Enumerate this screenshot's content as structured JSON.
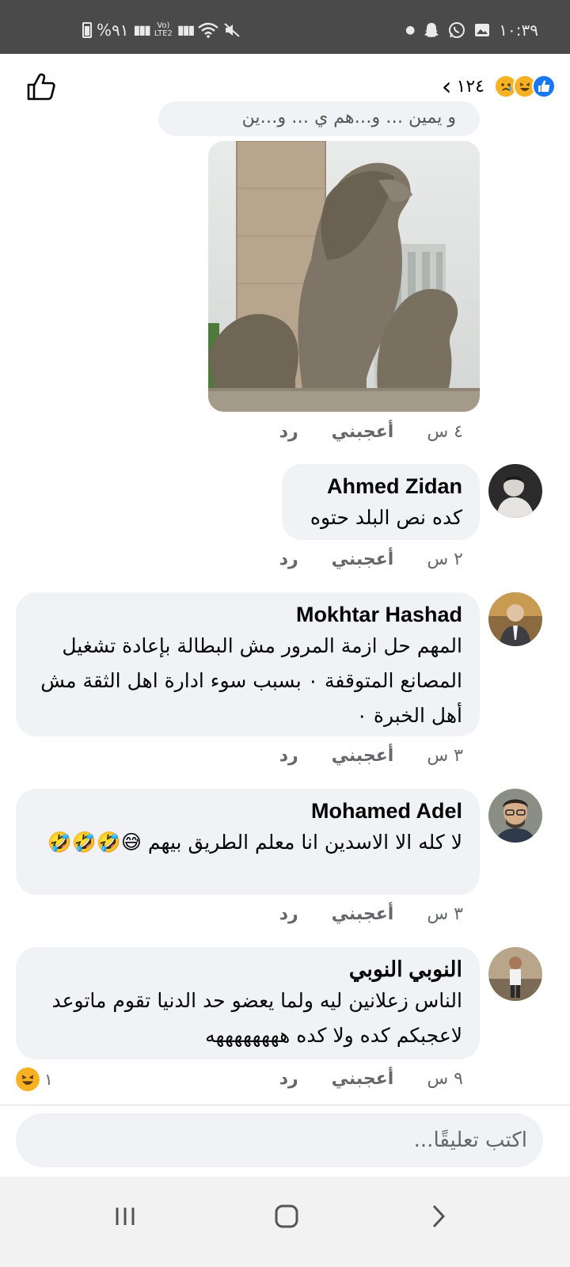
{
  "status_bar": {
    "time": "١٠:٣٩",
    "battery": "%٩١",
    "volte_top": "Vo)",
    "volte_bottom": "LTE2"
  },
  "header": {
    "reaction_count": "١٢٤",
    "reactions": [
      "sad-reaction-icon",
      "haha-reaction-icon",
      "like-reaction-icon"
    ]
  },
  "partial_comment_text": "و يمين … و…هم ي … و…ين",
  "photo_comment": {
    "time": "٤ س",
    "like_label": "أعجبني",
    "reply_label": "رد"
  },
  "comments": [
    {
      "name": "Ahmed Zidan",
      "text": "كده نص البلد حتوه",
      "time": "٢ س",
      "like_label": "أعجبني",
      "reply_label": "رد"
    },
    {
      "name": "Mokhtar Hashad",
      "text": "المهم حل ازمة المرور مش البطالة بإعادة تشغيل المصانع المتوقفة ٠ بسبب سوء ادارة اهل الثقة مش أهل الخبرة ٠",
      "time": "٣ س",
      "like_label": "أعجبني",
      "reply_label": "رد"
    },
    {
      "name": "Mohamed Adel",
      "text": "لا كله الا الاسدين انا معلم الطريق بيهم 😅🤣🤣🤣",
      "time": "٣ س",
      "like_label": "أعجبني",
      "reply_label": "رد"
    },
    {
      "name": "النوبي النوبي",
      "text": "الناس زعلانين ليه ولما يعضو حد الدنيا تقوم ماتوعد لاعجبكم كده ولا كده ههههههههه",
      "time": "٩ س",
      "like_label": "أعجبني",
      "reply_label": "رد",
      "reaction_count": "١"
    }
  ],
  "composer": {
    "placeholder": "اكتب تعليقًا..."
  },
  "colors": {
    "bubble": "#f0f2f5",
    "meta_text": "#65676b",
    "like_blue": "#1877f2",
    "status_bar": "#4a4a4a"
  }
}
